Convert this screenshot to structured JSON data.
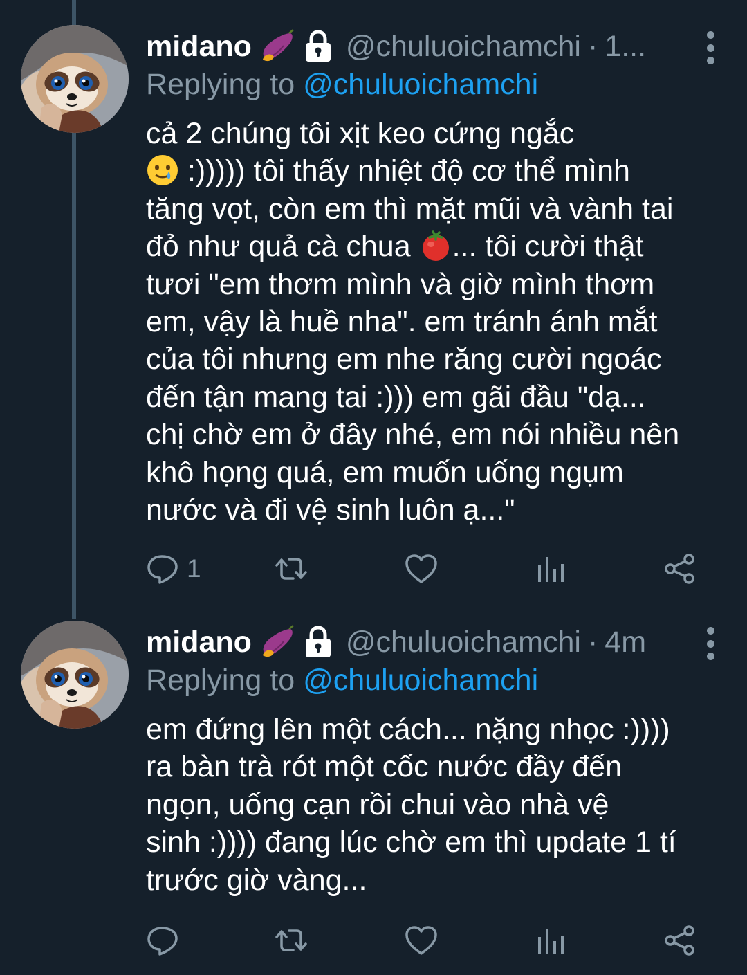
{
  "tweets": [
    {
      "display_name": "midano",
      "name_emoji": "sweet-potato-emoji",
      "protected_icon": "lock-icon",
      "handle": "@chuluoichamchi",
      "separator": "·",
      "time": "1...",
      "reply_prefix": "Replying to",
      "reply_handle": "@chuluoichamchi",
      "text_lines": [
        "cả 2 chúng tôi xịt keo cứng ngắc",
        ":))))) tôi thấy nhiệt độ cơ thể mình",
        "tăng vọt, còn em thì mặt mũi và vành tai",
        "đỏ như quả cà chua",
        "... tôi cười thật",
        "tươi \"em thơm mình và giờ mình thơm",
        "em, vậy là huề nha\". em tránh ánh mắt",
        "của tôi nhưng em nhe răng cười ngoác",
        "đến tận mang tai :))) em gãi đầu \"dạ...",
        "chị chờ em ở đây nhé, em nói nhiều nên",
        "khô họng quá, em muốn uống ngụm",
        "nước và đi vệ sinh luôn ạ...\""
      ],
      "inline_emojis": [
        "smiling-face-with-tear-emoji",
        "tomato-emoji"
      ],
      "reply_count": "1",
      "action_icons": [
        "reply-icon",
        "retweet-icon",
        "like-icon",
        "analytics-icon",
        "share-icon"
      ]
    },
    {
      "display_name": "midano",
      "name_emoji": "sweet-potato-emoji",
      "protected_icon": "lock-icon",
      "handle": "@chuluoichamchi",
      "separator": "·",
      "time": "4m",
      "reply_prefix": "Replying to",
      "reply_handle": "@chuluoichamchi",
      "text_lines": [
        "em đứng lên một cách... nặng nhọc :))))",
        "ra bàn trà rót một cốc nước đầy đến",
        "ngọn, uống cạn rồi chui vào nhà vệ",
        "sinh :)))) đang lúc chờ em thì update 1 tí",
        "trước giờ vàng..."
      ],
      "reply_count": "",
      "action_icons": [
        "reply-icon",
        "retweet-icon",
        "like-icon",
        "analytics-icon",
        "share-icon"
      ]
    }
  ],
  "colors": {
    "background": "#15202b",
    "text": "#ffffff",
    "secondary_text": "#8899a6",
    "link": "#1da1f2",
    "thread_line": "#3d5466"
  }
}
